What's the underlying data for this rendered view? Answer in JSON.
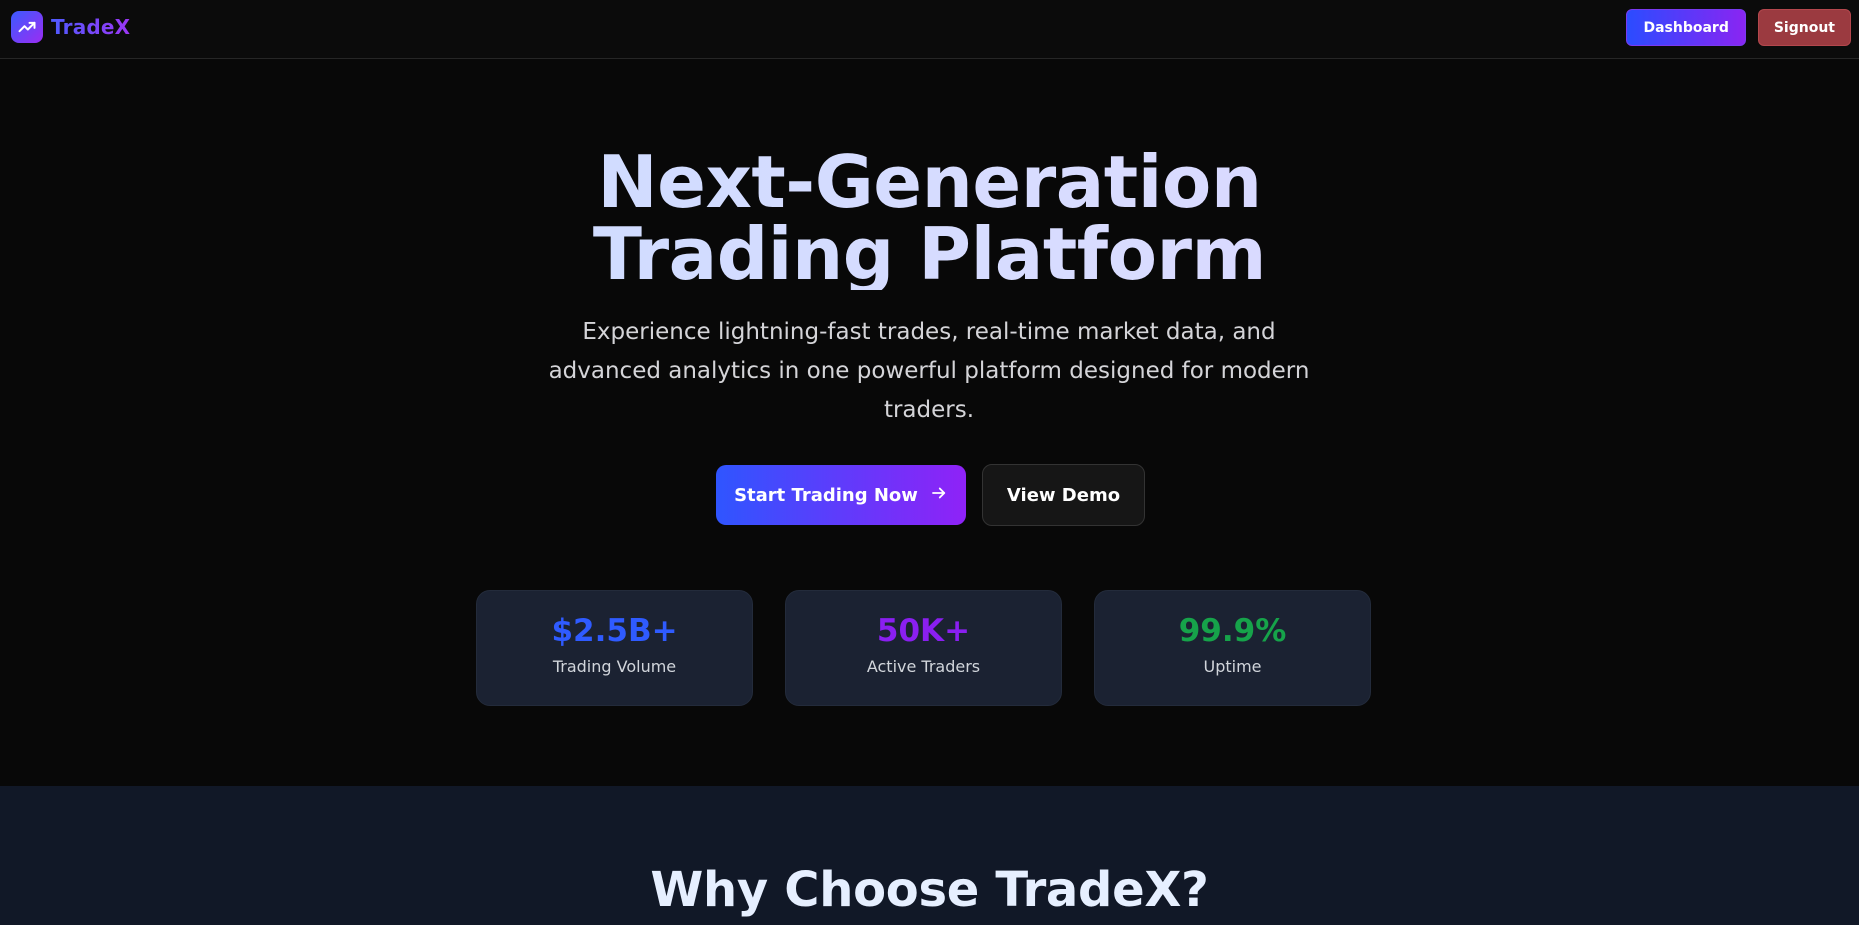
{
  "navbar": {
    "brand_name": "TradeX",
    "logo_icon": "trending-up-icon",
    "dashboard_label": "Dashboard",
    "signout_label": "Signout"
  },
  "hero": {
    "title_line1": "Next-Generation",
    "title_line2": "Trading Platform",
    "subtitle": "Experience lightning-fast trades, real-time market data, and advanced analytics in one powerful platform designed for modern traders.",
    "primary_cta": "Start Trading Now",
    "primary_cta_icon": "arrow-right-icon",
    "secondary_cta": "View Demo"
  },
  "stats": [
    {
      "value": "$2.5B+",
      "label": "Trading Volume",
      "color": "#2f5bff"
    },
    {
      "value": "50K+",
      "label": "Active Traders",
      "color": "#8a1ff0"
    },
    {
      "value": "99.9%",
      "label": "Uptime",
      "color": "#16a34a"
    }
  ],
  "features": {
    "title": "Why Choose TradeX?"
  },
  "colors": {
    "background": "#080808",
    "accent_blue": "#2f55ff",
    "accent_purple": "#8f22f7",
    "signout_red": "#9b3a40",
    "card_bg": "#1b2232",
    "section_bg": "#111827"
  }
}
